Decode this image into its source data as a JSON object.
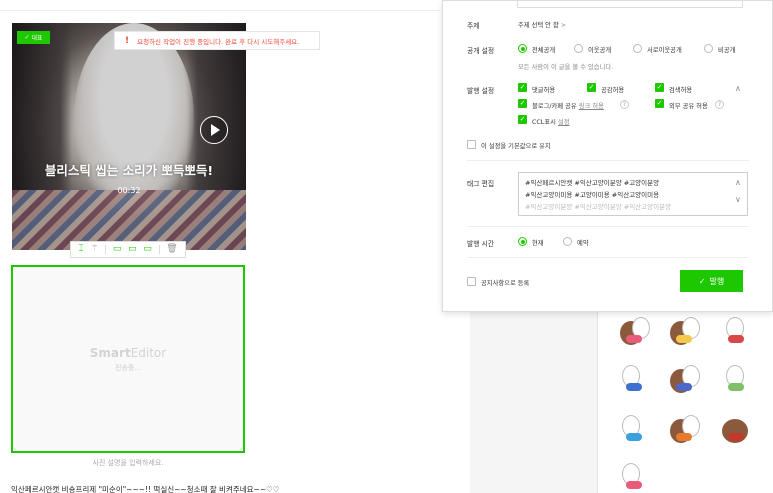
{
  "editor": {
    "video": {
      "badge": "대표",
      "title": "블리스틱 씹는 소리가 뽀득뽀득!",
      "duration": "00:32"
    },
    "warning": "요청하신 작업이 진행 중입니다. 완료 후 다시 시도해주세요.",
    "upload": {
      "logo_bold": "Smart",
      "logo_light": "Editor",
      "status": "전송중..."
    },
    "caption_placeholder": "사진 설명을 입력하세요.",
    "body_text": "익산페르시안캣 비숑프리제 \"미순이\"~~~!! 떡실신~~청소때 잘 비켜주네요~~♡♡"
  },
  "publish": {
    "topic": {
      "label": "주제",
      "value": "주제 선택 안 함",
      "arrow": ">"
    },
    "visibility": {
      "label": "공개 설정",
      "options": [
        "전체공개",
        "이웃공개",
        "서로이웃공개",
        "비공개"
      ],
      "selected": "전체공개",
      "hint": "모든 사람이 이 글을 볼 수 있습니다."
    },
    "publish_settings": {
      "label": "발행 설정",
      "items": {
        "comment": "댓글허용",
        "sympathy": "공감허용",
        "search": "검색허용",
        "blog_share": "블로그/카페 공유",
        "link_allow": "링크 허용",
        "external": "외부 공유 허용",
        "ccl": "CCL표시",
        "ccl_setting": "설정"
      },
      "help": "?",
      "collapse": "∧"
    },
    "keep_default": "이 설정을 기본값으로 유지",
    "tags": {
      "label": "태그 편집",
      "lines": [
        "#익산페르시안캣  #익산고양이분양  #고양이분양",
        "#익산고양이미용  #고양이미용  #익산고양이미용",
        "#익산고양이분양  #익산고양이분양  #익산고양이분양"
      ]
    },
    "time": {
      "label": "발행 시간",
      "options": [
        "현재",
        "예약"
      ],
      "selected": "현재"
    },
    "notice": "공지사항으로 등록",
    "button": "발행",
    "check_glyph": "✓"
  },
  "colors": {
    "accent": "#1ec800",
    "warning": "#f24b3b"
  }
}
